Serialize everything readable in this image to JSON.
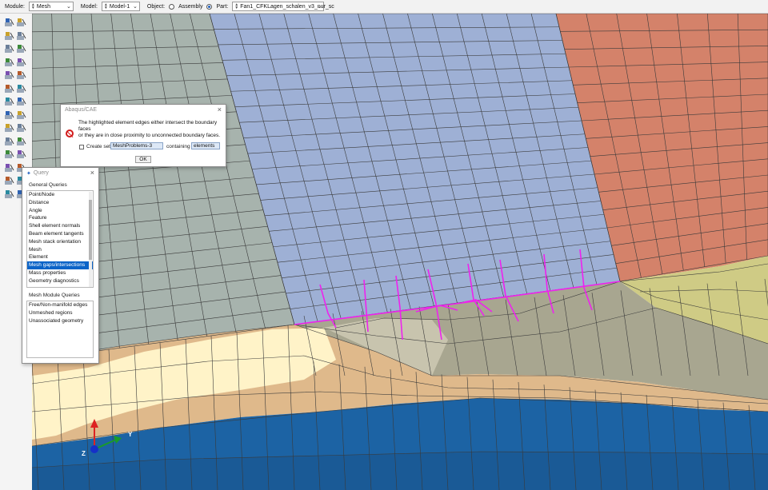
{
  "context_bar": {
    "module_label": "Module:",
    "module_value": "Mesh",
    "model_label": "Model:",
    "model_value": "Model-1",
    "object_label": "Object:",
    "assembly_label": "Assembly",
    "part_label": "Part:",
    "part_value": "Fan1_CFKLagen_schalen_v3_nur_sc",
    "selected_object": "Part"
  },
  "error_dialog": {
    "title": "Abaqus/CAE",
    "message_line1": "The highlighted element edges either intersect the boundary faces",
    "message_line2": "or they are in close proximity to unconnected boundary faces.",
    "create_set_label": "Create set",
    "set_name": "MeshProblems-3",
    "containing_label": "containing",
    "containing_value": "elements",
    "ok_label": "OK"
  },
  "query_panel": {
    "title": "Query",
    "general_header": "General Queries",
    "general_items": [
      "Point/Node",
      "Distance",
      "Angle",
      "Feature",
      "Shell element normals",
      "Beam element tangents",
      "Mesh stack orientation",
      "Mesh",
      "Element",
      "Mesh gaps/intersections",
      "Mass properties",
      "Geometry diagnostics"
    ],
    "selected_general": "Mesh gaps/intersections",
    "module_header": "Mesh Module Queries",
    "module_items": [
      "Free/Non-manifold edges",
      "Unmeshed regions",
      "Unassociated geometry"
    ]
  },
  "triad": {
    "y_label": "Y",
    "z_label": "Z"
  },
  "colors": {
    "grey_region": "#a7b3ad",
    "blue_region": "#9eb0d5",
    "orange_region": "#d4826a",
    "olive_region": "#cfcb85",
    "khaki_region": "#a8a690",
    "cream_region": "#fff3c8",
    "tan_region": "#dfb98b",
    "dark_blue_region": "#1c63a4",
    "highlight": "#ee22ee",
    "mesh_line": "#3a3a3a"
  },
  "toolbox_icons": [
    "seed-part-icon",
    "seed-edge-icon",
    "mesh-part-icon",
    "mesh-region-icon",
    "assign-element-type-icon",
    "mesh-controls-icon",
    "verify-mesh-icon",
    "delete-mesh-icon",
    "create-partition-icon",
    "datum-icon",
    "edit-mesh-icon",
    "virtual-topology-icon",
    "query-icon",
    "tools-icon"
  ]
}
